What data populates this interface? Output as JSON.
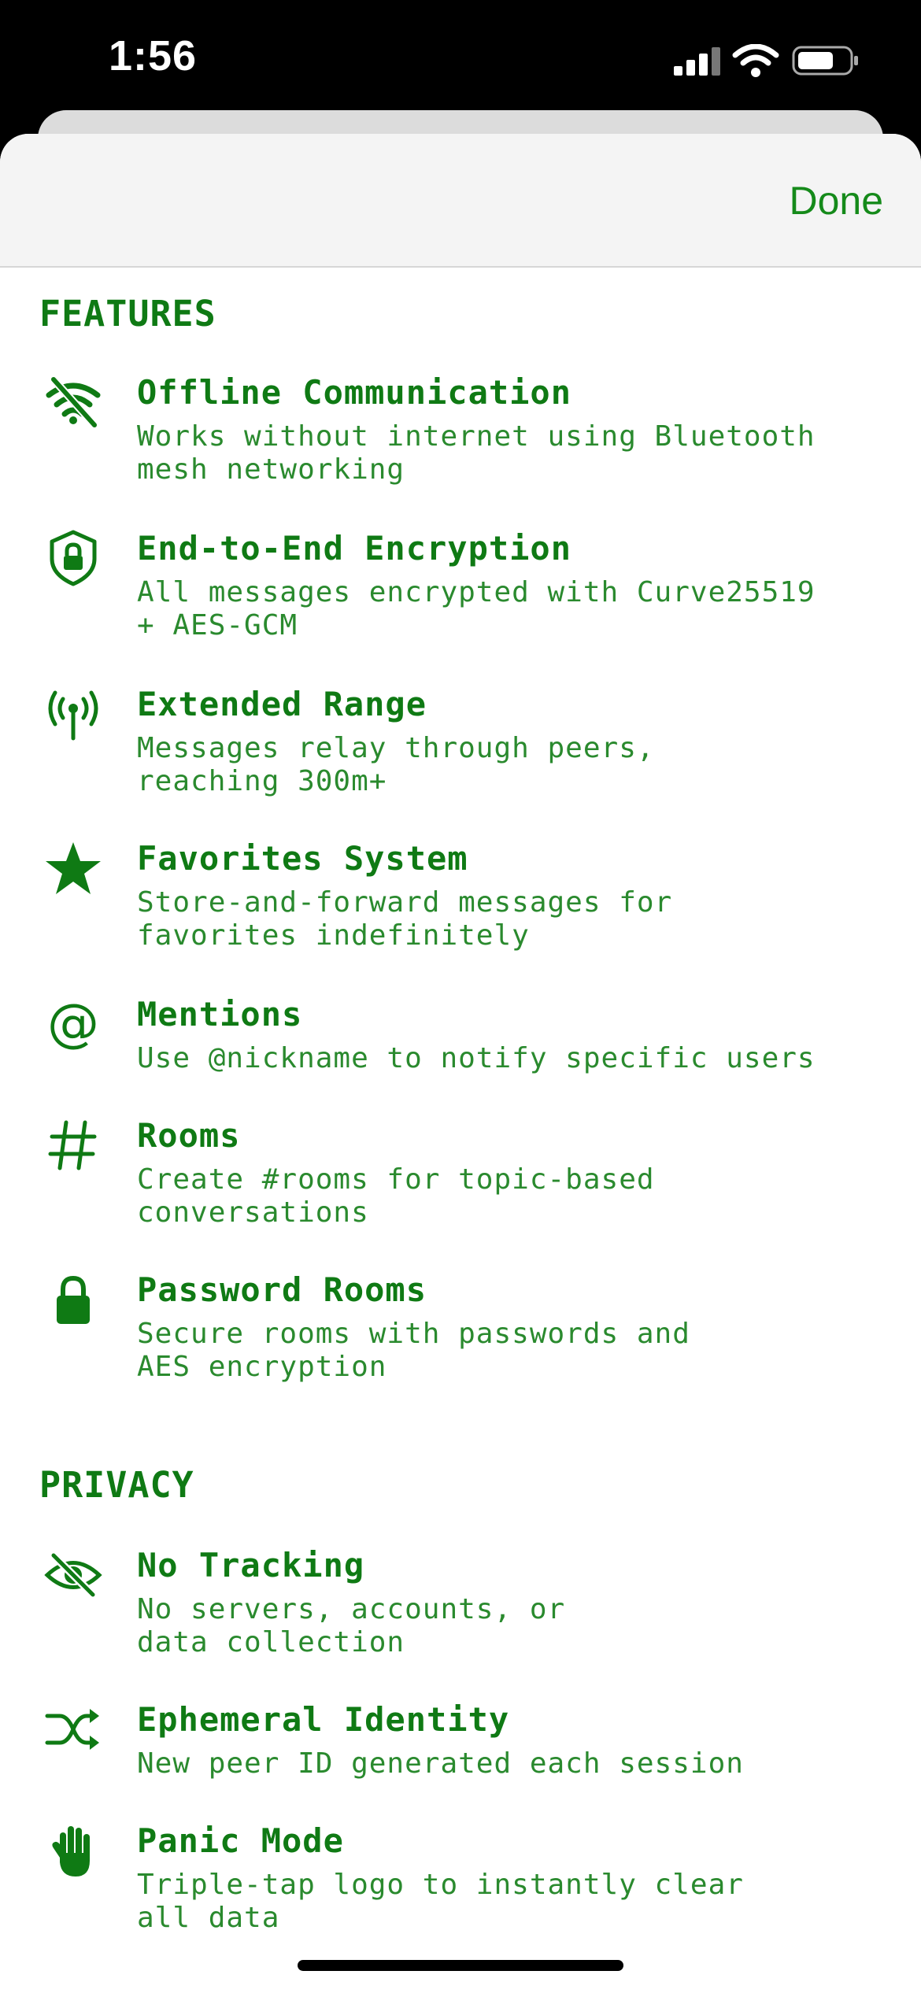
{
  "status": {
    "time": "1:56"
  },
  "nav": {
    "done_label": "Done"
  },
  "sections": [
    {
      "title": "FEATURES",
      "items": [
        {
          "icon": "wifi-off-icon",
          "title": "Offline Communication",
          "desc": "Works without internet using Bluetooth\nmesh networking"
        },
        {
          "icon": "lock-shield-icon",
          "title": "End-to-End Encryption",
          "desc": "All messages encrypted with Curve25519\n+ AES-GCM"
        },
        {
          "icon": "antenna-icon",
          "title": "Extended Range",
          "desc": "Messages relay through peers,\nreaching 300m+"
        },
        {
          "icon": "star-icon",
          "title": "Favorites System",
          "desc": "Store-and-forward messages for\nfavorites indefinitely"
        },
        {
          "icon": "at-icon",
          "title": "Mentions",
          "desc": "Use @nickname to notify specific users"
        },
        {
          "icon": "hash-icon",
          "title": "Rooms",
          "desc": "Create #rooms for topic-based\nconversations"
        },
        {
          "icon": "lock-icon",
          "title": "Password Rooms",
          "desc": "Secure rooms with passwords and\nAES encryption"
        }
      ]
    },
    {
      "title": "PRIVACY",
      "items": [
        {
          "icon": "eye-slash-icon",
          "title": "No Tracking",
          "desc": "No servers, accounts, or\ndata collection"
        },
        {
          "icon": "shuffle-icon",
          "title": "Ephemeral Identity",
          "desc": "New peer ID generated each session"
        },
        {
          "icon": "hand-raised-icon",
          "title": "Panic Mode",
          "desc": "Triple-tap logo to instantly clear\nall data"
        }
      ]
    }
  ],
  "colors": {
    "accent": "#0f7a14",
    "text": "#2a8a2e"
  }
}
